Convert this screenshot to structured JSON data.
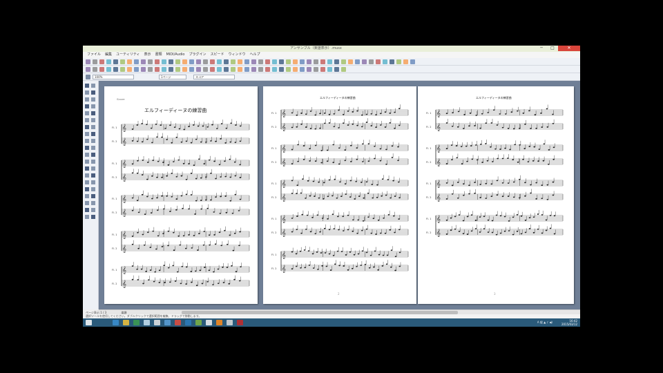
{
  "window": {
    "title": "アンサンブル（楽譜表示）.musx",
    "minimize_label": "─",
    "maximize_label": "□",
    "close_label": "✕"
  },
  "menu": [
    "ファイル",
    "編集",
    "ユーティリティ",
    "表示",
    "書類",
    "MIDI/Audio",
    "プラグイン",
    "スピード",
    "ウィンドウ",
    "ヘルプ"
  ],
  "toolbar3": {
    "zoom": "100%",
    "page_field": "1ページ",
    "staff_field": "スコア"
  },
  "score": {
    "page1_header": "Score",
    "page1_title": "エルフィーディーヌの練習曲",
    "page_header_small": "エルフィーディーヌの練習曲",
    "staff_upper_label": "Fl. 1",
    "staff_lower_label": "Fl. 2",
    "page_numbers": [
      "2",
      "3"
    ]
  },
  "status": {
    "page_indicator": "ページ表示 1 / 3",
    "page_button": "楽譜",
    "hint": "選択ツールを使用してください。ダブルクリックで選択範囲を編集、ドラッグで移動します。"
  },
  "taskbar": {
    "tray": "A 般 ▲ ♪ ◀)",
    "time": "16:42",
    "date": "2015/03/12"
  },
  "colors": {
    "title_bar": "#e9efd9",
    "close_button": "#d9453b",
    "workspace": "#6f7f96",
    "taskbar": "#2a5a7a"
  }
}
